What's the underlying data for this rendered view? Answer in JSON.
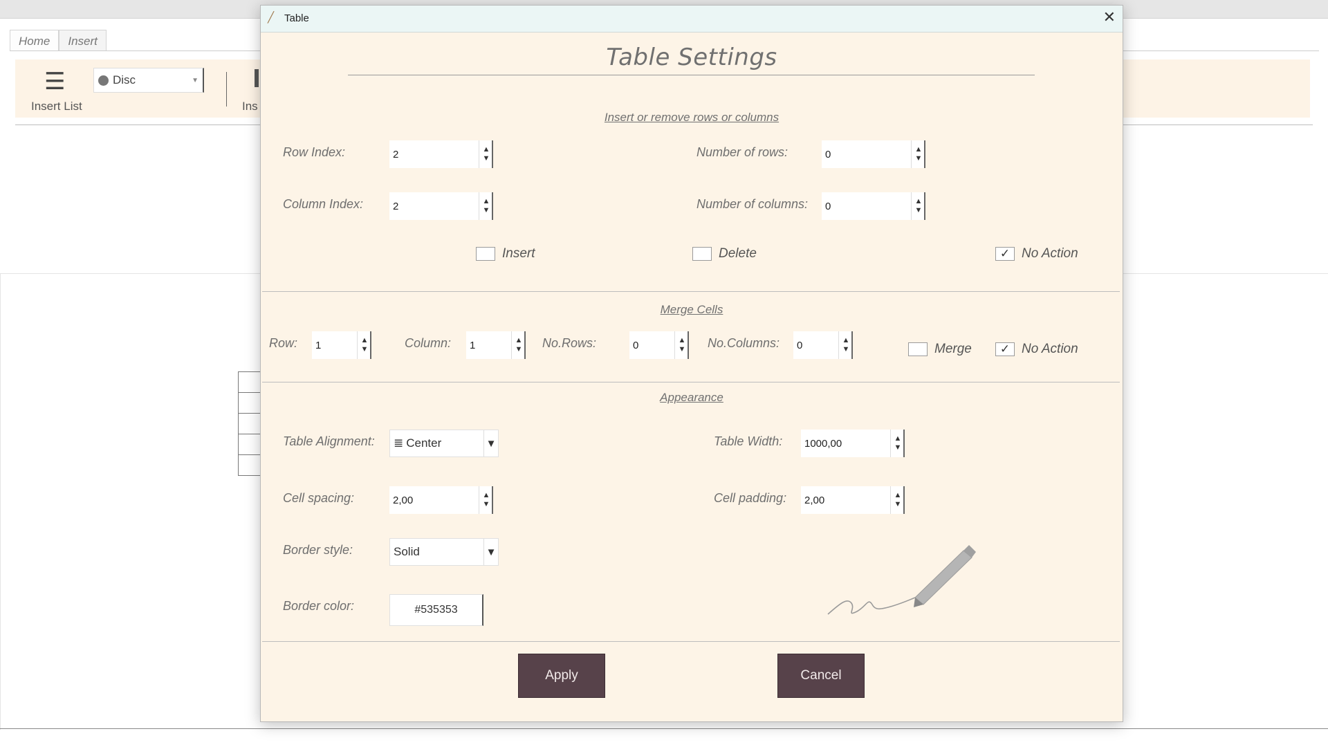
{
  "app": {
    "tabs": [
      {
        "label": "Home"
      },
      {
        "label": "Insert"
      }
    ],
    "ribbon": {
      "insert_list_label": "Insert List",
      "list_style": "Disc",
      "truncated_label": "Ins"
    }
  },
  "dialog": {
    "title": "Table",
    "heading": "Table Settings",
    "rows_cols": {
      "section_title": "Insert or remove rows or columns",
      "row_index_label": "Row Index:",
      "row_index_value": "2",
      "column_index_label": "Column Index:",
      "column_index_value": "2",
      "num_rows_label": "Number of rows:",
      "num_rows_value": "0",
      "num_columns_label": "Number of columns:",
      "num_columns_value": "0",
      "insert_label": "Insert",
      "insert_checked": false,
      "delete_label": "Delete",
      "delete_checked": false,
      "no_action_label": "No Action",
      "no_action_checked": true
    },
    "merge": {
      "section_title": "Merge Cells",
      "row_label": "Row:",
      "row_value": "1",
      "column_label": "Column:",
      "column_value": "1",
      "no_rows_label": "No.Rows:",
      "no_rows_value": "0",
      "no_columns_label": "No.Columns:",
      "no_columns_value": "0",
      "merge_label": "Merge",
      "merge_checked": false,
      "no_action_label": "No Action",
      "no_action_checked": true
    },
    "appearance": {
      "section_title": "Appearance",
      "table_alignment_label": "Table Alignment:",
      "table_alignment_value": "Center",
      "table_width_label": "Table Width:",
      "table_width_value": "1000,00",
      "cell_spacing_label": "Cell spacing:",
      "cell_spacing_value": "2,00",
      "cell_padding_label": "Cell padding:",
      "cell_padding_value": "2,00",
      "border_style_label": "Border style:",
      "border_style_value": "Solid",
      "border_color_label": "Border color:",
      "border_color_value": "#535353"
    },
    "buttons": {
      "apply": "Apply",
      "cancel": "Cancel"
    }
  },
  "icons": {
    "check_mark": "✓",
    "close": "✕",
    "up_arrow": "▲",
    "down_arrow": "▼",
    "list": "☰",
    "align_center": "≣",
    "dropdown_arrow": "▼",
    "title_icon": "pencil-icon"
  },
  "colors": {
    "dialog_bg": "#fdf4e7",
    "titlebar_bg": "#ebf6f5",
    "button_bg": "#57424a",
    "ribbon_bg": "#fdf3e6"
  }
}
